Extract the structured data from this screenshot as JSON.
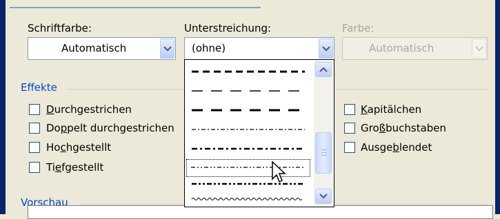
{
  "labels": {
    "font_color": "Schriftfarbe:",
    "underline": "Unterstreichung:",
    "color": "Farbe:"
  },
  "font_color_combo": {
    "value": "Automatisch"
  },
  "underline_combo": {
    "value": "(ohne)"
  },
  "color_combo": {
    "value": "Automatisch"
  },
  "effects": {
    "title": "Effekte",
    "items": [
      {
        "pre": "",
        "key": "D",
        "post": "urchgestrichen",
        "checked": false
      },
      {
        "pre": "Do",
        "key": "p",
        "post": "pelt durchgestrichen",
        "checked": false
      },
      {
        "pre": "Ho",
        "key": "c",
        "post": "hgestellt",
        "checked": false
      },
      {
        "pre": "Ti",
        "key": "e",
        "post": "fgestellt",
        "checked": false
      },
      {
        "pre": "",
        "key": "K",
        "post": "apitälchen",
        "checked": false
      },
      {
        "pre": "Gro",
        "key": "ß",
        "post": "buchstaben",
        "checked": false
      },
      {
        "pre": "Ausge",
        "key": "b",
        "post": "lendet",
        "checked": false
      }
    ]
  },
  "preview": {
    "title": "Vorschau"
  },
  "underline_dropdown": {
    "items": [
      "dashed-heavy",
      "dashed-long",
      "dash-long-heavy",
      "dash-dot",
      "dash-dot-heavy",
      "dash-dot-dot",
      "dash-dot-dot-heavy",
      "wave"
    ],
    "selected": "dash-dot-dot"
  },
  "colors": {
    "group_title": "#0046d5",
    "disabled_text": "#aca899",
    "window_blue": "#0a246a"
  }
}
